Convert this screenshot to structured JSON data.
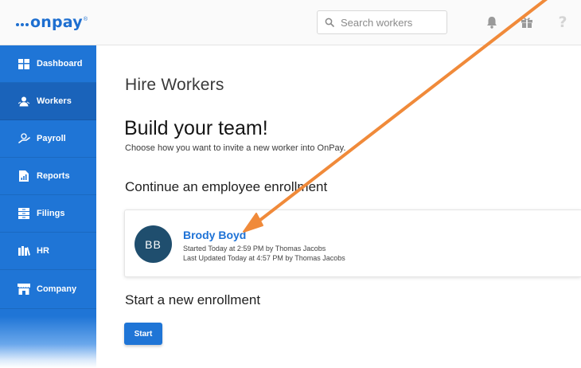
{
  "app": {
    "logo_text": "onpay",
    "logo_reg": "®"
  },
  "header": {
    "search_placeholder": "Search workers",
    "icons": [
      "search-icon",
      "bell-icon",
      "gift-icon",
      "help-icon"
    ],
    "help_glyph": "?"
  },
  "sidebar": {
    "items": [
      {
        "label": "Dashboard",
        "icon": "dashboard-icon",
        "active": false
      },
      {
        "label": "Workers",
        "icon": "workers-icon",
        "active": true
      },
      {
        "label": "Payroll",
        "icon": "payroll-icon",
        "active": false
      },
      {
        "label": "Reports",
        "icon": "reports-icon",
        "active": false
      },
      {
        "label": "Filings",
        "icon": "filings-icon",
        "active": false
      },
      {
        "label": "HR",
        "icon": "hr-icon",
        "active": false
      },
      {
        "label": "Company",
        "icon": "company-icon",
        "active": false
      }
    ]
  },
  "main": {
    "page_title": "Hire Workers",
    "hero_title": "Build your team!",
    "hero_subtitle": "Choose how you want to invite a new worker into OnPay.",
    "continue_title": "Continue an employee enrollment",
    "enrollment": {
      "initials": "BB",
      "name": "Brody Boyd",
      "started": "Started Today at 2:59 PM by Thomas Jacobs",
      "updated": "Last Updated Today at 4:57 PM by Thomas Jacobs"
    },
    "new_title": "Start a new enrollment",
    "start_label": "Start"
  },
  "colors": {
    "brand_blue": "#1f75d6",
    "sidebar_active": "#1a63ba",
    "avatar_bg": "#1f4e6e",
    "link_blue": "#1e72d6",
    "annotation_arrow": "#f08a3a"
  }
}
